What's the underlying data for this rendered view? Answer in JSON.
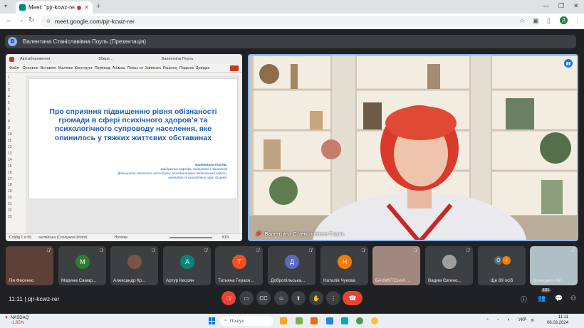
{
  "browser": {
    "tab_title": "Meet: \"pjr-kcwz-rer\"",
    "url": "meet.google.com/pjr-kcwz-rer",
    "profile_initial": "Д"
  },
  "presentation_bar": {
    "badge": "В",
    "title": "Валентина Станіславівна Поуль (Презентація)"
  },
  "powerpoint": {
    "titlebar_items": [
      "Автозбереження",
      "Збере...",
      "Валентина Поуль"
    ],
    "menu_items": [
      "Файл",
      "Основне",
      "Вставлення",
      "Малювання",
      "Конструктор",
      "Переходи",
      "Анімації",
      "Показ слайдів",
      "Записати",
      "Рецензування",
      "Подання",
      "Довідка"
    ],
    "slide_numbers": "1\n2\n3\n4\n5\n6\n7\n8\n9\n10\n11\n12\n13\n14\n15\n16\n17\n18\n19\n20\n21\n22\n23",
    "status_slide": "Слайд 1 із 56",
    "status_lang": "англійська (Сполучені Штати)",
    "status_notes": "Нотатки",
    "zoom": "81%"
  },
  "slide": {
    "heading": "Про сприяння підвищенню рівня обізнаності громади в сфері психічного здоров’я та психологічного супроводу населення, яке опинилось у тяжких життєвих обставинах",
    "author_name": "Валентина ПОУЛЬ,",
    "author_line1": "завідувачка кафедри педагогіки і психології",
    "author_line2": "Донецького обласного інституту післядипломної педагогічної освіти,",
    "author_line3": "кандидат психологічних наук, доцент"
  },
  "video": {
    "speaker_name": "Валентина Станіславівна Поуль"
  },
  "participants": [
    {
      "name": "Лія Фесенко",
      "type": "photo",
      "color": "#6d4c41"
    },
    {
      "name": "Марина Самар...",
      "type": "avatar",
      "initial": "М",
      "color": "#2e7d32"
    },
    {
      "name": "Александр Кр...",
      "type": "photo",
      "color": "#795548"
    },
    {
      "name": "Артур Кесоян",
      "type": "avatar",
      "initial": "А",
      "color": "#00897b"
    },
    {
      "name": "Татьяна Гераси...",
      "type": "avatar",
      "initial": "Т",
      "color": "#f4511e"
    },
    {
      "name": "Добропільська...",
      "type": "avatar",
      "initial": "Д",
      "color": "#5c6bc0"
    },
    {
      "name": "Наталія Чукова",
      "type": "avatar",
      "initial": "Н",
      "color": "#f57c00"
    },
    {
      "name": "БАХМУТСЬКА ...",
      "type": "photo",
      "color": "#a1887f"
    },
    {
      "name": "Вадим Євгено...",
      "type": "photo",
      "color": "#9e9e9e"
    },
    {
      "name": "Ще 89 осіб",
      "type": "more",
      "initials": [
        "О",
        "І"
      ]
    },
    {
      "name": "Донецька обл...",
      "type": "photo",
      "color": "#90a4ae"
    }
  ],
  "controls": {
    "time_code": "11:11 | pjr-kcwz-rer",
    "participant_count": "101"
  },
  "taskbar": {
    "ticker": "NASDAQ",
    "ticker_change": "-1.65%",
    "search_placeholder": "Пошук",
    "lang": "УКР",
    "time": "11:11",
    "date": "06.03.2024"
  }
}
